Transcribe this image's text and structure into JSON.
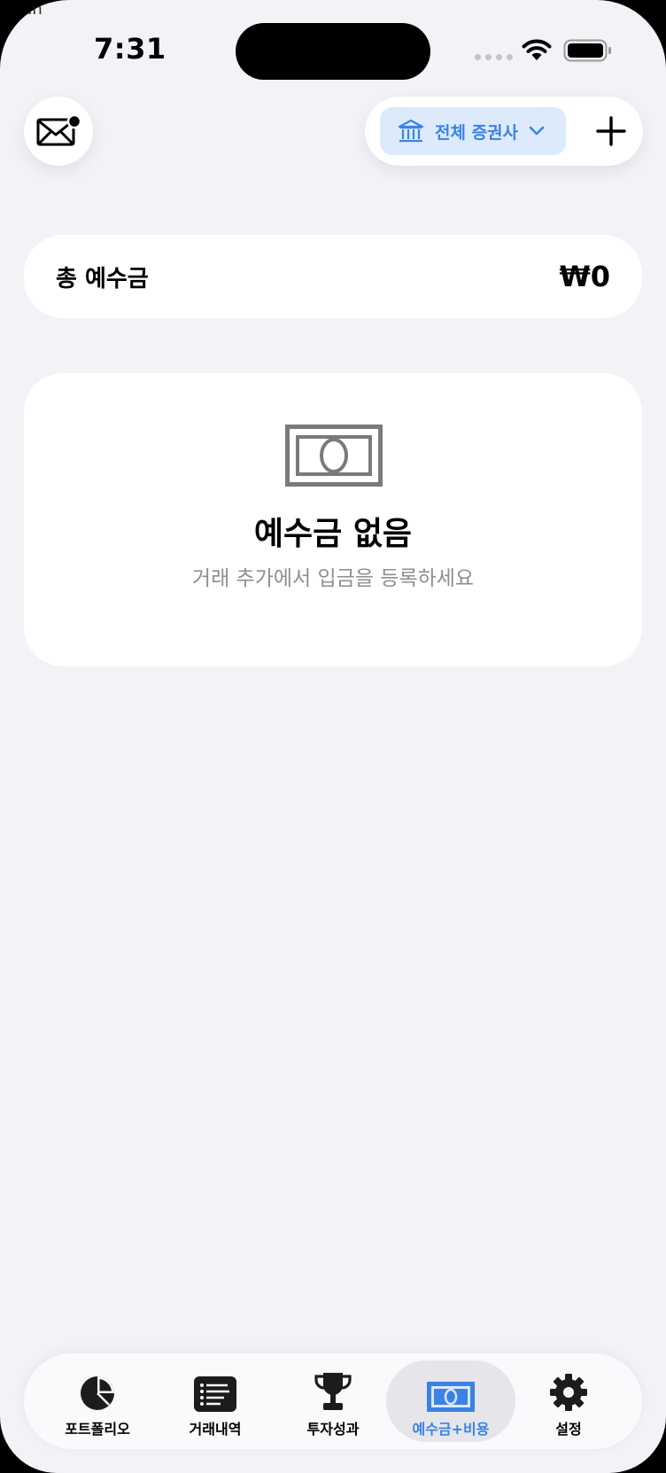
{
  "status_bar": {
    "time": "7:31",
    "corner_text": "Goun"
  },
  "toolbar": {
    "broker_filter_label": "전체 증권사",
    "accent_color": "#3b82e6"
  },
  "total_deposit": {
    "label": "총 예수금",
    "value": "₩0"
  },
  "empty_state": {
    "title": "예수금 없음",
    "subtitle": "거래 추가에서 입금을 등록하세요"
  },
  "tabs": [
    {
      "label": "포트폴리오",
      "icon": "pie-chart-icon",
      "active": false
    },
    {
      "label": "거래내역",
      "icon": "list-icon",
      "active": false
    },
    {
      "label": "투자성과",
      "icon": "trophy-icon",
      "active": false
    },
    {
      "label": "예수금+비용",
      "icon": "banknote-icon",
      "active": true
    },
    {
      "label": "설정",
      "icon": "gear-icon",
      "active": false
    }
  ]
}
